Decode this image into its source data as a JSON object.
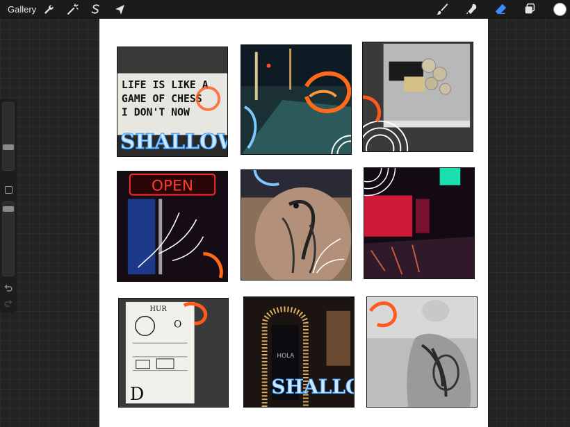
{
  "toolbar": {
    "gallery_label": "Gallery",
    "left_tools": [
      "wrench-icon",
      "magic-wand-icon",
      "selection-s-icon",
      "transform-arrow-icon"
    ],
    "right_tools": [
      "brush-icon",
      "smudge-icon",
      "eraser-icon",
      "layers-icon"
    ],
    "active_tool": "eraser-icon",
    "active_color": "#ffffff"
  },
  "sidebar": {
    "brush_size_level": 0.6,
    "opacity_level": 0.95
  },
  "canvas": {
    "background": "#ffffff",
    "tiles": [
      {
        "name": "tile-letter-board",
        "sign_lines": [
          "LIFE IS LIKE A",
          "GAME OF CHESS",
          "I DON'T NOW"
        ],
        "overlay_text": "SHALLOWS"
      },
      {
        "name": "tile-night-street"
      },
      {
        "name": "tile-coins-wallet"
      },
      {
        "name": "tile-open-sign",
        "sign_text": "OPEN"
      },
      {
        "name": "tile-peacock-tattoo"
      },
      {
        "name": "tile-neon-alley"
      },
      {
        "name": "tile-vintage-print",
        "print_letters": [
          "HUR",
          "O",
          "D"
        ]
      },
      {
        "name": "tile-mirror-bar",
        "overlay_text": "SHALLOWS",
        "mirror_text": "HOLA"
      },
      {
        "name": "tile-back-tattoo"
      }
    ]
  }
}
